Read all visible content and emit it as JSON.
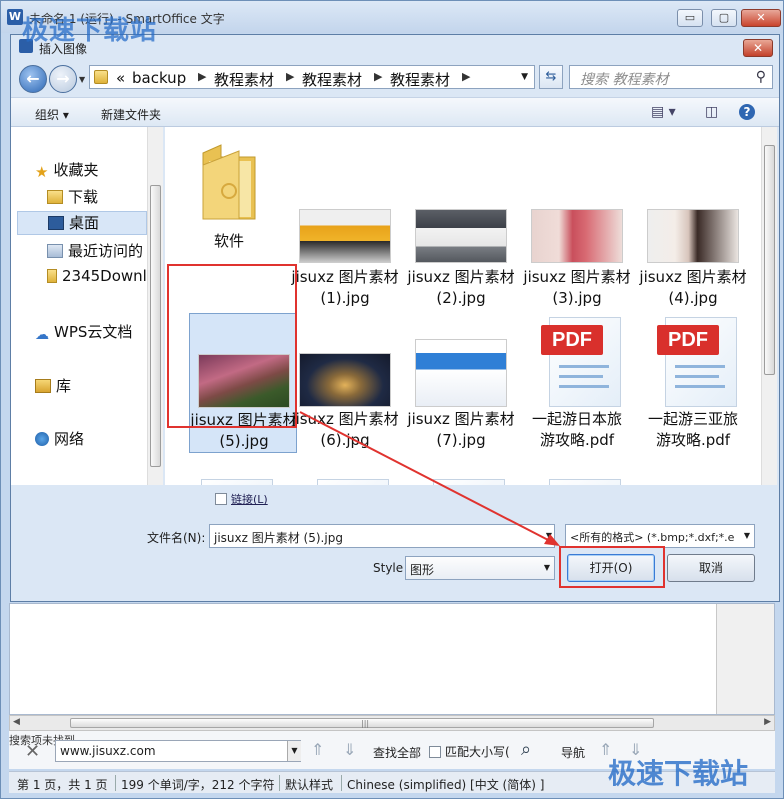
{
  "app": {
    "logo": "W",
    "title": "未命名 1 (运行) - SmartOffice 文字",
    "min_label": "▭",
    "max_label": "▢",
    "close_label": "✕"
  },
  "watermark": {
    "top": "极速下载站",
    "bottom": "极速下载站"
  },
  "dialog": {
    "title": "插入图像",
    "close_label": "✕",
    "breadcrumb": [
      "backup",
      "教程素材",
      "教程素材",
      "教程素材"
    ],
    "breadcrumb_prefix": "«",
    "search_placeholder": "搜索 教程素材",
    "toolbar": {
      "organize": "组织 ▾",
      "new_folder": "新建文件夹"
    },
    "nav": {
      "favorites": "收藏夹",
      "downloads": "下载",
      "desktop": "桌面",
      "recent": "最近访问的",
      "folder2345": "2345Downl",
      "wps_cloud": "WPS云文档",
      "library": "库",
      "network": "网络"
    },
    "files": [
      {
        "name": "软件",
        "kind": "folder"
      },
      {
        "name": "jisuxz 图片素材 (1).jpg",
        "kind": "image",
        "color": "#e8a21a"
      },
      {
        "name": "jisuxz 图片素材 (2).jpg",
        "kind": "image",
        "color": "#9ea3aa"
      },
      {
        "name": "jisuxz 图片素材 (3).jpg",
        "kind": "image",
        "color": "#c94f5c"
      },
      {
        "name": "jisuxz 图片素材 (4).jpg",
        "kind": "image",
        "color": "#d8c5bc"
      },
      {
        "name": "jisuxz 图片素材 (5).jpg",
        "kind": "image",
        "color": "#a24f63",
        "selected": true
      },
      {
        "name": "jisuxz 图片素材 (6).jpg",
        "kind": "image",
        "color": "#1f2a44"
      },
      {
        "name": "jisuxz 图片素材 (7).jpg",
        "kind": "image",
        "color": "#2f7fd6"
      },
      {
        "name": "一起游日本旅游攻略.pdf",
        "kind": "pdf"
      },
      {
        "name": "一起游三亚旅游攻略.pdf",
        "kind": "pdf"
      }
    ],
    "pdf_tag": "PDF",
    "link_label": "链接(L)",
    "filename_label": "文件名(N):",
    "filename_value": "jisuxz 图片素材 (5).jpg",
    "filter_value": "<所有的格式> (*.bmp;*.dxf;*.e",
    "style_label": "Style",
    "style_value": "图形",
    "open_button": "打开(O)",
    "cancel_button": "取消"
  },
  "findbar": {
    "status": "搜索项未找到",
    "search_value": "www.jisuxz.com",
    "find_all": "查找全部",
    "match_case": "匹配大小写(",
    "navigate": "导航"
  },
  "status": {
    "page": "第 1 页，共 1 页",
    "words": "199 个单词/字，212 个字符",
    "style": "默认样式",
    "language": "Chinese (simplified) [中文 (简体) ]"
  },
  "colors": {
    "annotation": "#e0332f",
    "accent": "#2b5ea7"
  }
}
